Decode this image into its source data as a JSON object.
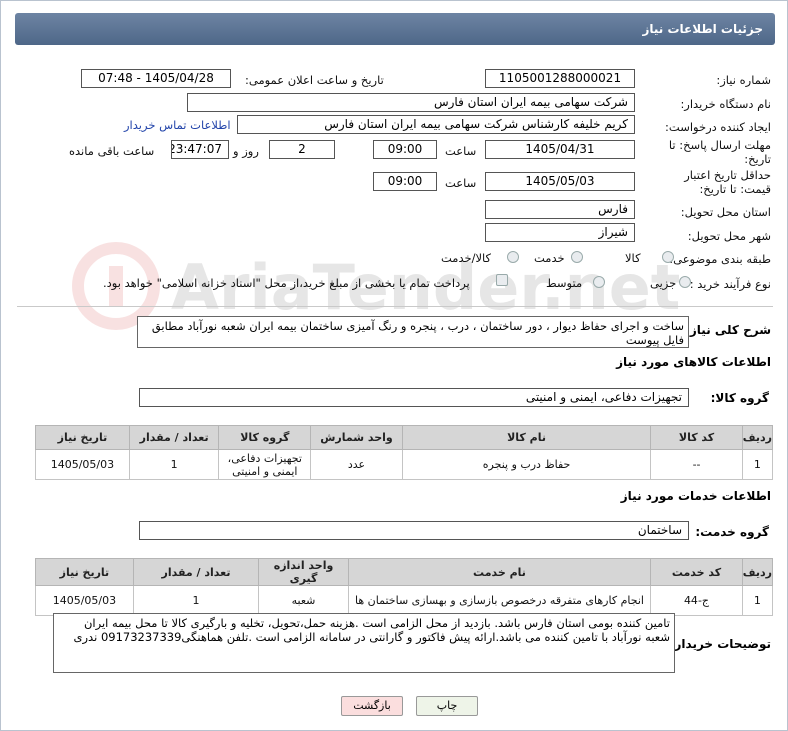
{
  "header": {
    "title": "جزئیات اطلاعات نیاز"
  },
  "fields": {
    "need_number_label": "شماره نیاز:",
    "need_number": "1105001288000021",
    "announce_label": "تاریخ و ساعت اعلان عمومی:",
    "announce_value": "1405/04/28 - 07:48",
    "buyer_org_label": "نام دستگاه خریدار:",
    "buyer_org": "شرکت سهامی بیمه ایران استان فارس",
    "requester_label": "ایجاد کننده درخواست:",
    "requester": "کریم خلیفه کارشناس شرکت سهامی بیمه ایران استان فارس",
    "contact_link": "اطلاعات تماس خریدار",
    "deadline_label": "مهلت ارسال پاسخ: تا تاریخ:",
    "deadline_date": "1405/04/31",
    "time_label": "ساعت",
    "deadline_time": "09:00",
    "days_value": "2",
    "days_label": "روز و",
    "remaining_time": "23:47:07",
    "remaining_label": "ساعت باقی مانده",
    "validity_label": "حداقل تاریخ اعتبار قیمت: تا تاریخ:",
    "validity_date": "1405/05/03",
    "validity_time": "09:00",
    "province_label": "استان محل تحویل:",
    "province": "فارس",
    "city_label": "شهر محل تحویل:",
    "city": "شیراز",
    "category_label": "طبقه بندی موضوعی:",
    "category_options": [
      "کالا",
      "خدمت",
      "کالا/خدمت"
    ],
    "process_label": "نوع فرآیند خرید :",
    "process_options": [
      "جزیی",
      "متوسط"
    ],
    "payment_note": "پرداخت تمام یا بخشی از مبلغ خرید،از محل \"اسناد خزانه اسلامی\" خواهد بود."
  },
  "description": {
    "label": "شرح کلی نیاز:",
    "text": "ساخت و اجرای حفاظ دیوار ، دور ساختمان ، درب ، پنجره و رنگ آمیزی ساختمان بیمه ایران شعبه نورآباد مطابق فایل پیوست"
  },
  "goods": {
    "section_title": "اطلاعات کالاهای مورد نیاز",
    "group_label": "گروه کالا:",
    "group_value": "تجهیزات دفاعی، ایمنی و امنیتی",
    "columns": [
      "ردیف",
      "کد کالا",
      "نام کالا",
      "واحد شمارش",
      "گروه کالا",
      "تعداد / مقدار",
      "تاریخ نیاز"
    ],
    "rows": [
      [
        "1",
        "--",
        "حفاظ درب و پنجره",
        "عدد",
        "تجهیزات دفاعی، ایمنی و امنیتی",
        "1",
        "1405/05/03"
      ]
    ]
  },
  "services": {
    "section_title": "اطلاعات خدمات مورد نیاز",
    "group_label": "گروه خدمت:",
    "group_value": "ساختمان",
    "columns": [
      "ردیف",
      "کد خدمت",
      "نام خدمت",
      "واحد اندازه گیری",
      "تعداد / مقدار",
      "تاریخ نیاز"
    ],
    "rows": [
      [
        "1",
        "ج-44",
        "انجام کارهای متفرقه درخصوص بازسازی و بهسازی ساختمان ها",
        "شعبه",
        "1",
        "1405/05/03"
      ]
    ]
  },
  "buyer_notes": {
    "label": "توضیحات خریدار:",
    "text": "تامین کننده بومی استان فارس باشد. بازدید از محل الزامی است .هزینه حمل،تحویل، تخلیه و بارگیری کالا تا محل بیمه ایران شعبه نورآباد با تامین کننده می باشد.ارائه پیش فاکتور و گارانتی در سامانه الزامی است .تلفن هماهنگی09173237339 ندری"
  },
  "buttons": {
    "print": "چاپ",
    "back": "بازگشت"
  },
  "watermark": {
    "text": "AriaTender.net"
  },
  "colors": {
    "header": "#5a7394",
    "back_button": "#fbdede",
    "print_button": "#eef4e8",
    "link": "#2244aa"
  }
}
